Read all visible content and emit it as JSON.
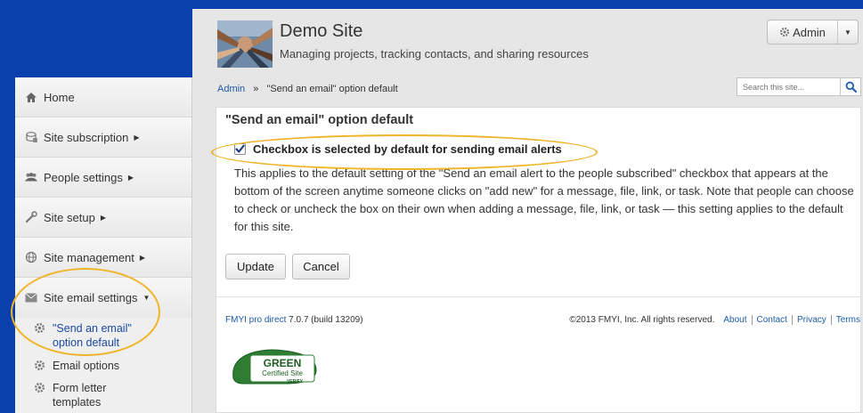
{
  "header": {
    "title": "Demo Site",
    "subtitle": "Managing projects, tracking contacts, and sharing resources",
    "admin_label": "Admin"
  },
  "breadcrumb": {
    "root": "Admin",
    "separator": "»",
    "current": "\"Send an email\" option default"
  },
  "search": {
    "placeholder": "Search this site..."
  },
  "sidebar": {
    "items": [
      {
        "label": "Home",
        "icon": "home-icon"
      },
      {
        "label": "Site subscription",
        "icon": "subscription-icon"
      },
      {
        "label": "People settings",
        "icon": "people-icon"
      },
      {
        "label": "Site setup",
        "icon": "wrench-icon"
      },
      {
        "label": "Site management",
        "icon": "globe-icon"
      },
      {
        "label": "Site email settings",
        "icon": "envelope-icon"
      }
    ],
    "subitems": [
      {
        "label": "\"Send an email\" option default",
        "active": true
      },
      {
        "label": "Email options",
        "active": false
      },
      {
        "label": "Form letter templates",
        "active": false
      }
    ]
  },
  "card": {
    "title": "\"Send an email\" option default",
    "checkbox_label": "Checkbox is selected by default for sending email alerts",
    "checkbox_checked": true,
    "description": "This applies to the default setting of the \"Send an email alert to the people subscribed\" checkbox that appears at the bottom of the screen anytime someone clicks on \"add new\" for a message, file, link, or task. Note that people can choose to check or uncheck the box on their own when adding a message, file, link, or task — this setting applies to the default for this site.",
    "update_label": "Update",
    "cancel_label": "Cancel"
  },
  "footer": {
    "product_link": "FMYI pro direct",
    "version": "7.0.7 (build 13209)",
    "copyright": "©2013 FMYI, Inc. All rights reserved.",
    "links": [
      "About",
      "Contact",
      "Privacy",
      "Terms"
    ],
    "badge_line1": "GREEN",
    "badge_line2": "Certified Site",
    "badge_line3": "VERIFY"
  },
  "colors": {
    "page_bg": "#0b3fae",
    "link": "#1a5aa8",
    "highlight": "#f0b429"
  }
}
